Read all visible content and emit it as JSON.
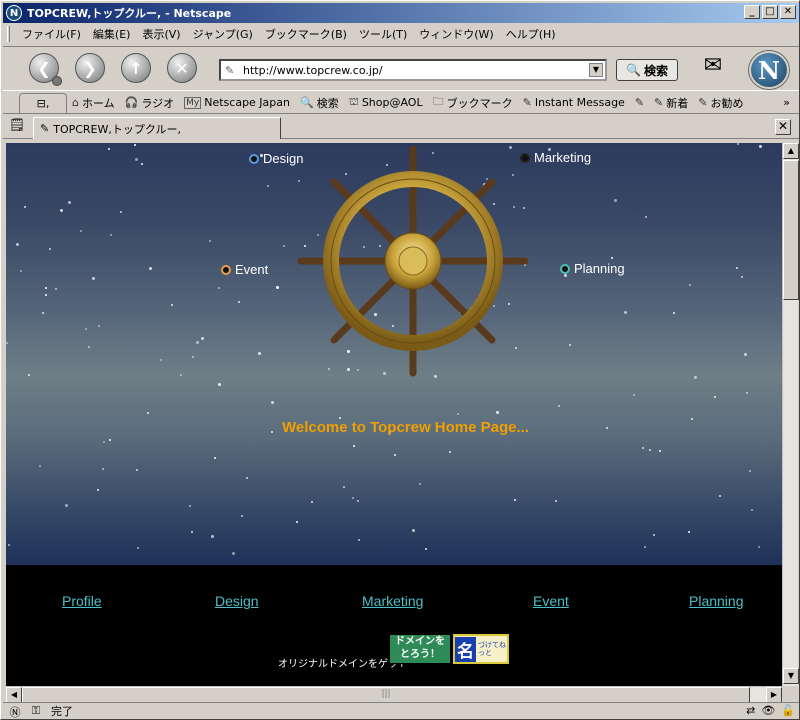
{
  "window": {
    "title": "TOPCREW,トップクルー, - Netscape",
    "app_logo": "N",
    "buttons": [
      "_",
      "□",
      "✕"
    ]
  },
  "menubar": {
    "items": [
      "ファイル(F)",
      "編集(E)",
      "表示(V)",
      "ジャンプ(G)",
      "ブックマーク(B)",
      "ツール(T)",
      "ウィンドウ(W)",
      "ヘルプ(H)"
    ]
  },
  "navbar": {
    "back_icon": "back-arrow-icon",
    "forward_icon": "forward-arrow-icon",
    "reload_icon": "reload-icon",
    "stop_icon": "stop-icon",
    "url": "http://www.topcrew.co.jp/",
    "search_label": "検索",
    "netscape_logo": "N"
  },
  "personal_toolbar": {
    "items": [
      {
        "icon": "⌂",
        "label": "ホーム"
      },
      {
        "icon": "🎧",
        "label": "ラジオ"
      },
      {
        "icon": "My",
        "label": "Netscape Japan"
      },
      {
        "icon": "🔍",
        "label": "検索"
      },
      {
        "icon": "⛫",
        "label": "Shop@AOL"
      },
      {
        "icon": "🗀",
        "label": "ブックマーク"
      },
      {
        "icon": "✎",
        "label": "Instant Message"
      },
      {
        "icon": "✎",
        "label": ""
      },
      {
        "icon": "✎",
        "label": "新着"
      },
      {
        "icon": "✎",
        "label": "お勧め"
      }
    ],
    "more": "»"
  },
  "tab": {
    "title": "TOPCREW,トップクルー,"
  },
  "page": {
    "nav_top": {
      "design": "Design",
      "marketing": "Marketing",
      "event": "Event",
      "planning": "Planning"
    },
    "welcome": "Welcome to Topcrew Home Page...",
    "bottom_links": [
      "Profile",
      "Design",
      "Marketing",
      "Event",
      "Planning"
    ],
    "domain_text": "オリジナルドメインをゲット",
    "banner1_line1": "ドメインを",
    "banner1_line2": "とろう！",
    "banner2_main": "名",
    "banner2_sub": "づけてねっと",
    "colors": {
      "welcome": "#f0a000",
      "link": "#4cc0c8",
      "design_dot": "#5b9bd5",
      "marketing_dot": "#222222",
      "event_dot": "#e8a040",
      "planning_dot": "#4cc0b0"
    }
  },
  "statusbar": {
    "text": "完了"
  }
}
